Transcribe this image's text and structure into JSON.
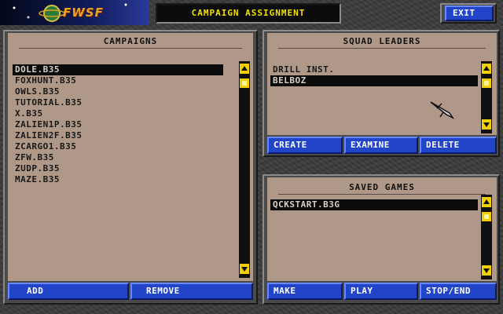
{
  "header": {
    "logo_text": "FWSF",
    "title": "CAMPAIGN ASSIGNMENT",
    "exit_label": "EXIT"
  },
  "campaigns": {
    "title": "CAMPAIGNS",
    "items": [
      "DOLE.B35",
      "FOXHUNT.B35",
      "OWLS.B35",
      "TUTORIAL.B35",
      "X.B35",
      "ZALIEN1P.B35",
      "ZALIEN2F.B35",
      "ZCARGO1.B35",
      "ZFW.B35",
      "ZUDP.B35",
      "MAZE.B35"
    ],
    "selected_index": 0,
    "add_label": "ADD",
    "remove_label": "REMOVE"
  },
  "squad_leaders": {
    "title": "SQUAD LEADERS",
    "items": [
      "DRILL INST.",
      "BELBOZ"
    ],
    "selected_index": 1,
    "create_label": "CREATE",
    "examine_label": "EXAMINE",
    "delete_label": "DELETE"
  },
  "saved_games": {
    "title": "SAVED GAMES",
    "items": [
      "QCKSTART.B3G"
    ],
    "selected_index": 0,
    "make_label": "MAKE",
    "play_label": "PLAY",
    "stop_label": "STOP/END"
  },
  "colors": {
    "panel": "#b09888",
    "button": "#2244c8",
    "scroll_accent": "#f2d000",
    "title_bar": "#f2e000"
  },
  "icons": {
    "logo": "planet-logo-icon",
    "cursor": "ship-cursor-icon"
  }
}
